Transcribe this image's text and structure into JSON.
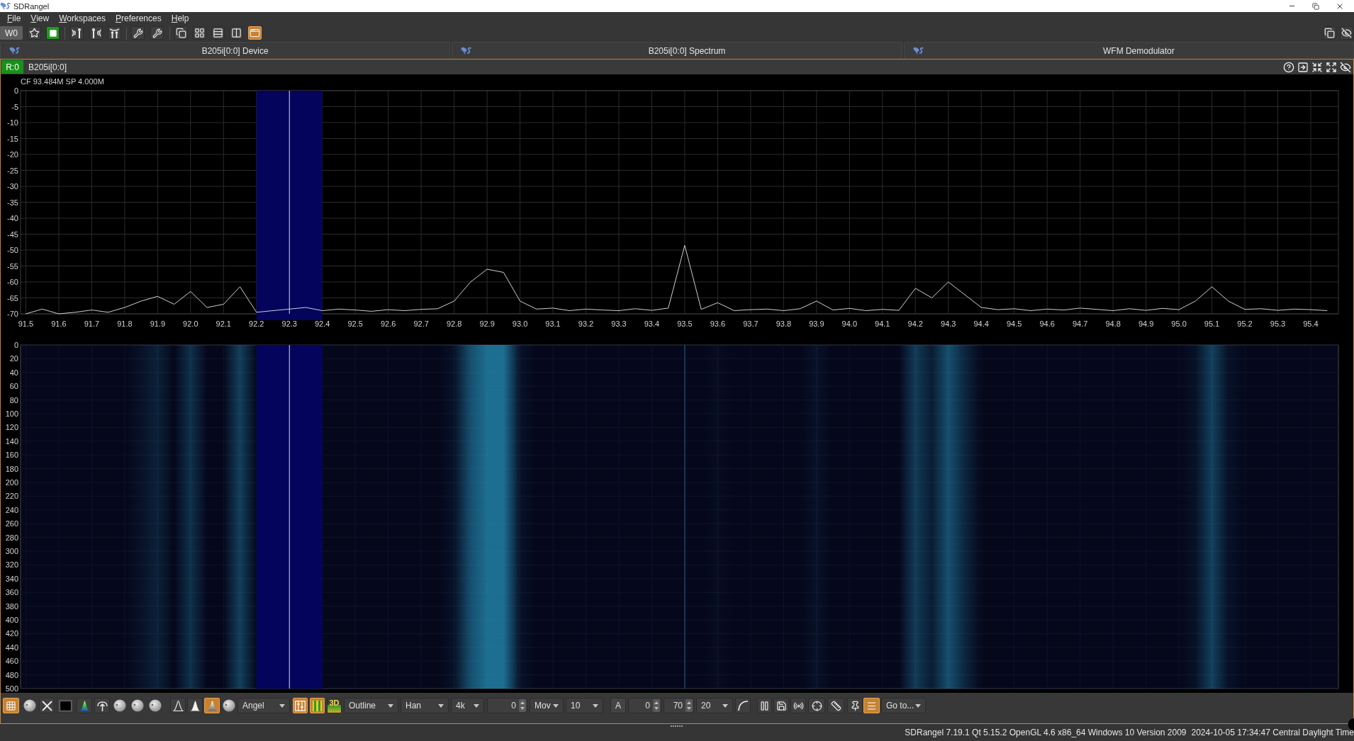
{
  "window": {
    "title": "SDRangel"
  },
  "menu": [
    "File",
    "View",
    "Workspaces",
    "Preferences",
    "Help"
  ],
  "toolbar": {
    "workspace_button": "W0",
    "acquisition_running": true,
    "arrange_buttons": [
      {
        "on": false
      },
      {
        "on": false
      },
      {
        "on": false
      },
      {
        "on": false
      },
      {
        "on": true
      }
    ]
  },
  "subwindows": [
    {
      "title": "B205i[0:0] Device"
    },
    {
      "title": "B205i[0:0] Spectrum"
    },
    {
      "title": "WFM Demodulator"
    }
  ],
  "spectrum": {
    "stream_badge": "R:0",
    "device": "B205i[0:0]",
    "info": "CF 93.484M SP 4.000M",
    "chart_data": {
      "type": "line",
      "x": [
        91.5,
        91.55,
        91.6,
        91.65,
        91.7,
        91.75,
        91.8,
        91.85,
        91.9,
        91.95,
        92,
        92.05,
        92.1,
        92.15,
        92.2,
        92.25,
        92.3,
        92.35,
        92.4,
        92.45,
        92.5,
        92.55,
        92.6,
        92.65,
        92.7,
        92.75,
        92.8,
        92.85,
        92.9,
        92.95,
        93,
        93.05,
        93.1,
        93.15,
        93.2,
        93.25,
        93.3,
        93.35,
        93.4,
        93.45,
        93.5,
        93.55,
        93.6,
        93.65,
        93.7,
        93.75,
        93.8,
        93.85,
        93.9,
        93.95,
        94,
        94.05,
        94.1,
        94.15,
        94.2,
        94.25,
        94.3,
        94.35,
        94.4,
        94.45,
        94.5,
        94.55,
        94.6,
        94.65,
        94.7,
        94.75,
        94.8,
        94.85,
        94.9,
        94.95,
        95,
        95.05,
        95.1,
        95.15,
        95.2,
        95.25,
        95.3,
        95.35,
        95.4,
        95.45
      ],
      "values": [
        -70,
        -68.5,
        -70,
        -69.5,
        -68.8,
        -69.5,
        -68,
        -66,
        -64.5,
        -67,
        -63,
        -68,
        -67,
        -61.5,
        -69.5,
        -69,
        -68.5,
        -68,
        -69,
        -68.5,
        -68.8,
        -69.2,
        -68.7,
        -69,
        -68.6,
        -68.4,
        -66,
        -60,
        -56,
        -57,
        -66,
        -68.5,
        -68.2,
        -69,
        -68.5,
        -68.8,
        -69,
        -68.4,
        -68.9,
        -68.2,
        -48.5,
        -68.6,
        -66.5,
        -69,
        -68.7,
        -68.5,
        -69,
        -68.4,
        -66,
        -68.8,
        -68.3,
        -69,
        -68.6,
        -68.9,
        -62,
        -65,
        -60,
        -64,
        -68,
        -68.7,
        -68.4,
        -69,
        -68.5,
        -68.8,
        -68.2,
        -68.6,
        -69,
        -68.4,
        -68.9,
        -68.3,
        -68.7,
        -66,
        -61.5,
        -66,
        -68.6,
        -68.4,
        -68.9,
        -68.5,
        -68.7,
        -69
      ],
      "xlim": [
        91.484,
        95.484
      ],
      "ylim": [
        -70,
        0
      ],
      "xticks": [
        91.5,
        91.6,
        91.7,
        91.8,
        91.9,
        {
          "value": 92,
          "label": "92.0"
        },
        92.1,
        92.2,
        92.3,
        92.4,
        92.5,
        92.6,
        92.7,
        92.8,
        92.9,
        {
          "value": 93,
          "label": "93.0"
        },
        93.1,
        93.2,
        93.3,
        93.4,
        93.5,
        93.6,
        93.7,
        93.8,
        93.9,
        {
          "value": 94,
          "label": "94.0"
        },
        94.1,
        94.2,
        94.3,
        94.4,
        94.5,
        94.6,
        94.7,
        94.8,
        94.9,
        {
          "value": 95,
          "label": "95.0"
        },
        95.1,
        95.2,
        95.3,
        95.4
      ],
      "yticks": [
        0,
        -5,
        -10,
        -15,
        -20,
        -25,
        -30,
        -35,
        -40,
        -45,
        -50,
        -55,
        -60,
        -65,
        -70
      ],
      "grid": true,
      "bands": [
        {
          "axis": "x",
          "from": 92.2,
          "to": 92.4,
          "color": "#04045c"
        }
      ],
      "ref_lines": [
        {
          "axis": "x",
          "value": 92.3,
          "color": "#d8d8f0"
        }
      ]
    },
    "waterfall": {
      "y_labels": [
        "0",
        "20",
        "40",
        "60",
        "80",
        "100",
        "120",
        "140",
        "160",
        "180",
        "200",
        "220",
        "240",
        "260",
        "280",
        "300",
        "320",
        "340",
        "360",
        "380",
        "400",
        "420",
        "440",
        "460",
        "480",
        "500"
      ]
    },
    "toolbar": [
      {
        "kind": "toggle",
        "on": true
      },
      {
        "kind": "dial"
      },
      {
        "kind": "toggle",
        "on": false
      },
      {
        "kind": "toggle",
        "on": false
      },
      {
        "kind": "toggle",
        "on": false
      },
      {
        "kind": "toggle",
        "on": false
      },
      {
        "kind": "dial"
      },
      {
        "kind": "dial"
      },
      {
        "kind": "dial"
      },
      {
        "kind": "toggle",
        "on": false
      },
      {
        "kind": "toggle",
        "on": false
      },
      {
        "kind": "toggle",
        "on": true
      },
      {
        "kind": "dial"
      },
      {
        "kind": "combo",
        "value": "Angel"
      },
      {
        "kind": "toggle",
        "on": true
      },
      {
        "kind": "toggle",
        "on": true
      },
      {
        "kind": "text_toggle",
        "label": "3D",
        "on": false
      },
      {
        "kind": "combo",
        "value": "Outline"
      },
      {
        "kind": "combo",
        "value": "Han"
      },
      {
        "kind": "combo",
        "value": "4k"
      },
      {
        "kind": "spinbox",
        "value": "0"
      },
      {
        "kind": "combo",
        "value": "Mov"
      },
      {
        "kind": "combo",
        "value": "10"
      },
      {
        "kind": "text_button",
        "label": "A"
      },
      {
        "kind": "spinbox",
        "value": "0"
      },
      {
        "kind": "spinbox",
        "value": "70"
      },
      {
        "kind": "combo",
        "value": "20"
      },
      {
        "kind": "toggle",
        "on": false
      },
      {
        "kind": "toggle",
        "on": false
      },
      {
        "kind": "toggle",
        "on": false
      },
      {
        "kind": "toggle",
        "on": false
      },
      {
        "kind": "toggle",
        "on": false
      },
      {
        "kind": "toggle",
        "on": false
      },
      {
        "kind": "toggle",
        "on": false
      },
      {
        "kind": "toggle",
        "on": true
      },
      {
        "kind": "combo",
        "value": "Go to..."
      }
    ]
  },
  "status_bar": {
    "version": "SDRangel 7.19.1 Qt 5.15.2 OpenGL 4.6 x86_64 Windows 10 Version 2009",
    "datetime": "2024-10-05 17:34:47 Central Daylight Time"
  }
}
